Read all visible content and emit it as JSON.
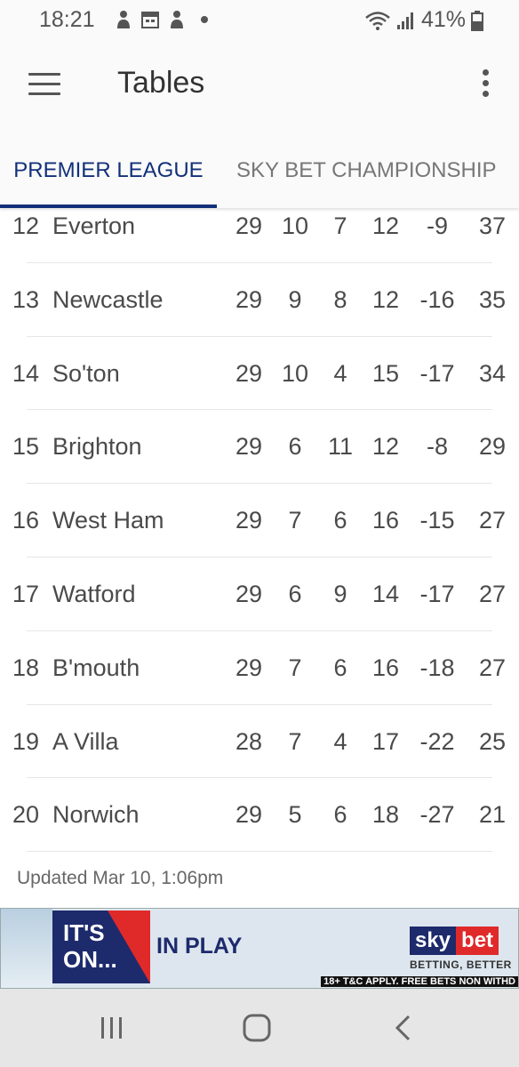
{
  "status_bar": {
    "time": "18:21",
    "battery": "41%"
  },
  "app_bar": {
    "title": "Tables"
  },
  "tabs": [
    {
      "label": "PREMIER LEAGUE",
      "active": true
    },
    {
      "label": "SKY BET CHAMPIONSHIP",
      "active": false
    }
  ],
  "table": {
    "rows": [
      {
        "pos": "12",
        "team": "Everton",
        "p": "29",
        "w": "10",
        "d": "7",
        "l": "12",
        "gd": "-9",
        "pts": "37"
      },
      {
        "pos": "13",
        "team": "Newcastle",
        "p": "29",
        "w": "9",
        "d": "8",
        "l": "12",
        "gd": "-16",
        "pts": "35"
      },
      {
        "pos": "14",
        "team": "So'ton",
        "p": "29",
        "w": "10",
        "d": "4",
        "l": "15",
        "gd": "-17",
        "pts": "34"
      },
      {
        "pos": "15",
        "team": "Brighton",
        "p": "29",
        "w": "6",
        "d": "11",
        "l": "12",
        "gd": "-8",
        "pts": "29"
      },
      {
        "pos": "16",
        "team": "West Ham",
        "p": "29",
        "w": "7",
        "d": "6",
        "l": "16",
        "gd": "-15",
        "pts": "27"
      },
      {
        "pos": "17",
        "team": "Watford",
        "p": "29",
        "w": "6",
        "d": "9",
        "l": "14",
        "gd": "-17",
        "pts": "27"
      },
      {
        "pos": "18",
        "team": "B'mouth",
        "p": "29",
        "w": "7",
        "d": "6",
        "l": "16",
        "gd": "-18",
        "pts": "27"
      },
      {
        "pos": "19",
        "team": "A Villa",
        "p": "28",
        "w": "7",
        "d": "4",
        "l": "17",
        "gd": "-22",
        "pts": "25"
      },
      {
        "pos": "20",
        "team": "Norwich",
        "p": "29",
        "w": "5",
        "d": "6",
        "l": "18",
        "gd": "-27",
        "pts": "21"
      }
    ],
    "updated": "Updated Mar 10, 1:06pm"
  },
  "ad": {
    "headline": "IT'S ON...",
    "subhead": "IN PLAY",
    "logo_sky": "sky",
    "logo_bet": "bet",
    "tagline": "BETTING, BETTER",
    "legal": "18+ T&C APPLY. FREE BETS NON WITHD"
  },
  "colors": {
    "accent": "#12307a",
    "sky_blue": "#1d2a6c",
    "sky_red": "#e02a2a"
  },
  "icons": {
    "menu": "hamburger-icon",
    "overflow": "more-vert-icon",
    "nav_recent": "recent-apps-icon",
    "nav_home": "home-icon",
    "nav_back": "back-icon"
  }
}
